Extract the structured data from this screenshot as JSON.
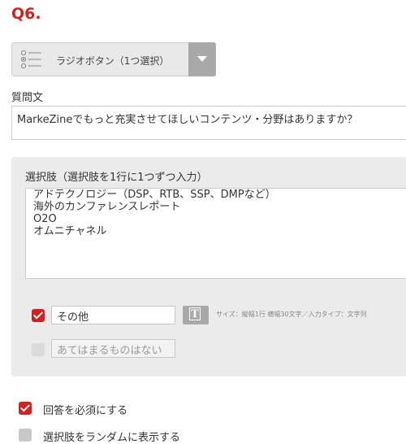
{
  "question_number": "Q6.",
  "question_type": {
    "label": "ラジオボタン（1つ選択）",
    "icon": "radio-list-icon"
  },
  "question_text": {
    "label": "質問文",
    "value": "MarkeZineでもっと充実させてほしいコンテンツ・分野はありますか？"
  },
  "options": {
    "label": "選択肢（選択肢を1行に1つずつ入力）",
    "lines": [
      "アドテクノロジー（DSP、RTB、SSP、DMPなど）",
      "海外のカンファレンスレポート",
      "O2O",
      "オムニチャネル"
    ]
  },
  "other": {
    "checked": true,
    "value": "その他",
    "text_icon": "T",
    "hint": "サイズ：縦幅1行 横幅30文字／入力タイプ：文字列"
  },
  "none_option": {
    "checked": false,
    "value": "あてはまるものはない"
  },
  "settings": {
    "required": {
      "label": "回答を必須にする",
      "checked": true
    },
    "random": {
      "label": "選択肢をランダムに表示する",
      "checked": false
    }
  },
  "colors": {
    "accent": "#d81e1e",
    "panel": "#ebebeb",
    "button_gray": "#a9a9a9"
  }
}
